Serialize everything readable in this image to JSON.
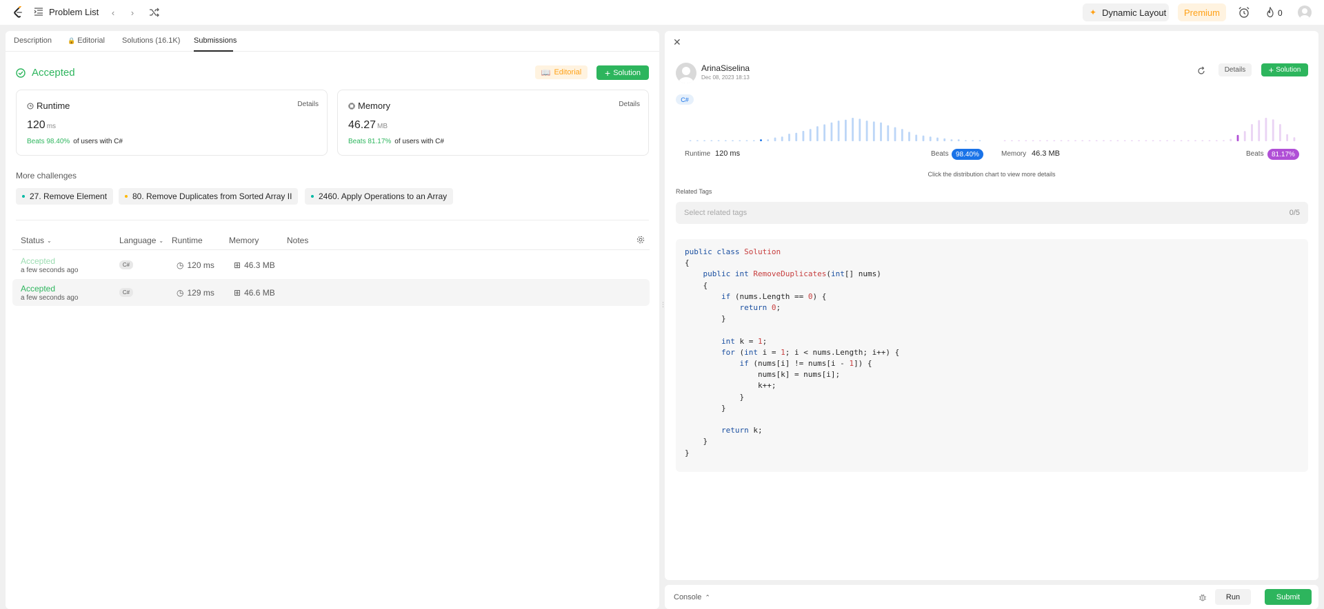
{
  "topbar": {
    "problem_list": "Problem List",
    "dynamic_layout": "Dynamic Layout",
    "premium": "Premium",
    "streak_count": "0"
  },
  "left": {
    "tabs": [
      {
        "label": "Description"
      },
      {
        "label": "Editorial"
      },
      {
        "label": "Solutions (16.1K)"
      },
      {
        "label": "Submissions"
      }
    ],
    "status_title": "Accepted",
    "editorial_btn": "Editorial",
    "solution_btn": "Solution",
    "runtime": {
      "label": "Runtime",
      "details": "Details",
      "value": "120",
      "unit": "ms",
      "beats": "Beats 98.40%",
      "of": "of users with C#"
    },
    "memory": {
      "label": "Memory",
      "details": "Details",
      "value": "46.27",
      "unit": "MB",
      "beats": "Beats 81.17%",
      "of": "of users with C#"
    },
    "more_challenges": "More challenges",
    "challenges": [
      {
        "label": "27. Remove Element",
        "color": "#00b8a3"
      },
      {
        "label": "80. Remove Duplicates from Sorted Array II",
        "color": "#ffb800"
      },
      {
        "label": "2460. Apply Operations to an Array",
        "color": "#00b8a3"
      }
    ],
    "table_headers": {
      "status": "Status",
      "language": "Language",
      "runtime": "Runtime",
      "memory": "Memory",
      "notes": "Notes"
    },
    "rows": [
      {
        "status": "Accepted",
        "time": "a few seconds ago",
        "lang": "C#",
        "runtime": "120 ms",
        "memory": "46.3 MB"
      },
      {
        "status": "Accepted",
        "time": "a few seconds ago",
        "lang": "C#",
        "runtime": "129 ms",
        "memory": "46.6 MB"
      }
    ]
  },
  "right": {
    "username": "ArinaSiselina",
    "date": "Dec 08, 2023 18:13",
    "details_btn": "Details",
    "solution_btn": "Solution",
    "lang_tag": "C#",
    "runtime_label": "Runtime",
    "runtime_value": "120 ms",
    "runtime_beats_label": "Beats",
    "runtime_beats": "98.40%",
    "memory_label": "Memory",
    "memory_value": "46.3 MB",
    "memory_beats_label": "Beats",
    "memory_beats": "81.17%",
    "hint": "Click the distribution chart to view more details",
    "related_tags": "Related Tags",
    "tags_placeholder": "Select related tags",
    "tags_count": "0/5",
    "code_lines": [
      "public class Solution",
      "{",
      "    public int RemoveDuplicates(int[] nums)",
      "    {",
      "        if (nums.Length == 0) {",
      "            return 0;",
      "        }",
      "",
      "        int k = 1;",
      "        for (int i = 1; i < nums.Length; i++) {",
      "            if (nums[i] != nums[i - 1]) {",
      "                nums[k] = nums[i];",
      "                k++;",
      "            }",
      "        }",
      "",
      "        return k;",
      "    }",
      "}"
    ]
  },
  "console": {
    "label": "Console",
    "run": "Run",
    "submit": "Submit"
  },
  "colors": {
    "accent_green": "#2db55d",
    "accent_orange": "#ffa116",
    "runtime_blue": "#1a73e8",
    "memory_purple": "#b04fd6"
  },
  "runtime_distribution": [
    1,
    1,
    1,
    1,
    1,
    1,
    1,
    1,
    1,
    1,
    2,
    2,
    4,
    5,
    8,
    9,
    11,
    13,
    16,
    18,
    20,
    22,
    23,
    25,
    24,
    22,
    21,
    20,
    17,
    15,
    13,
    10,
    7,
    6,
    5,
    4,
    3,
    2,
    2,
    1,
    1,
    1
  ],
  "memory_distribution": [
    1,
    1,
    1,
    1,
    1,
    1,
    1,
    1,
    1,
    1,
    1,
    1,
    1,
    1,
    1,
    1,
    1,
    1,
    1,
    1,
    1,
    1,
    1,
    1,
    1,
    1,
    1,
    1,
    1,
    1,
    1,
    1,
    3,
    8,
    13,
    22,
    27,
    30,
    28,
    22,
    9,
    5
  ]
}
